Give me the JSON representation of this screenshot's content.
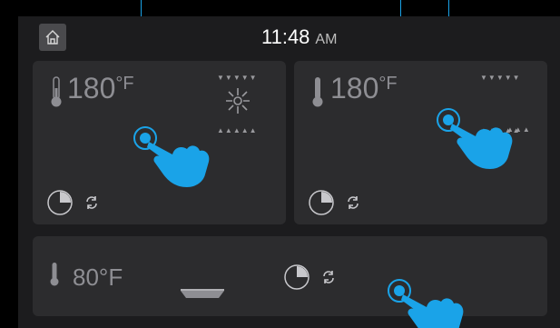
{
  "clock": {
    "time": "11:48",
    "ampm": "AM"
  },
  "panels": {
    "left": {
      "temp_value": "180",
      "temp_unit": "°F",
      "mode": "convection-fan",
      "fan_glyph": "❄"
    },
    "right": {
      "temp_value": "180",
      "temp_unit": "°F",
      "mode": "bake"
    },
    "bottom": {
      "temp_label": "80°F",
      "mode": "warming-drawer"
    }
  },
  "arrows": {
    "down": "▼▼▼▼▼",
    "up": "▲▲▲▲▲"
  },
  "icons": [
    "home-icon",
    "thermometer-icon",
    "timer-icon",
    "refresh-icon",
    "fan-icon",
    "tray-icon",
    "tap-gesture-icon"
  ],
  "colors": {
    "background": "#1c1c1e",
    "panel": "#2c2c2e",
    "text": "#8e8e93",
    "accent": "#1aa3e8"
  }
}
